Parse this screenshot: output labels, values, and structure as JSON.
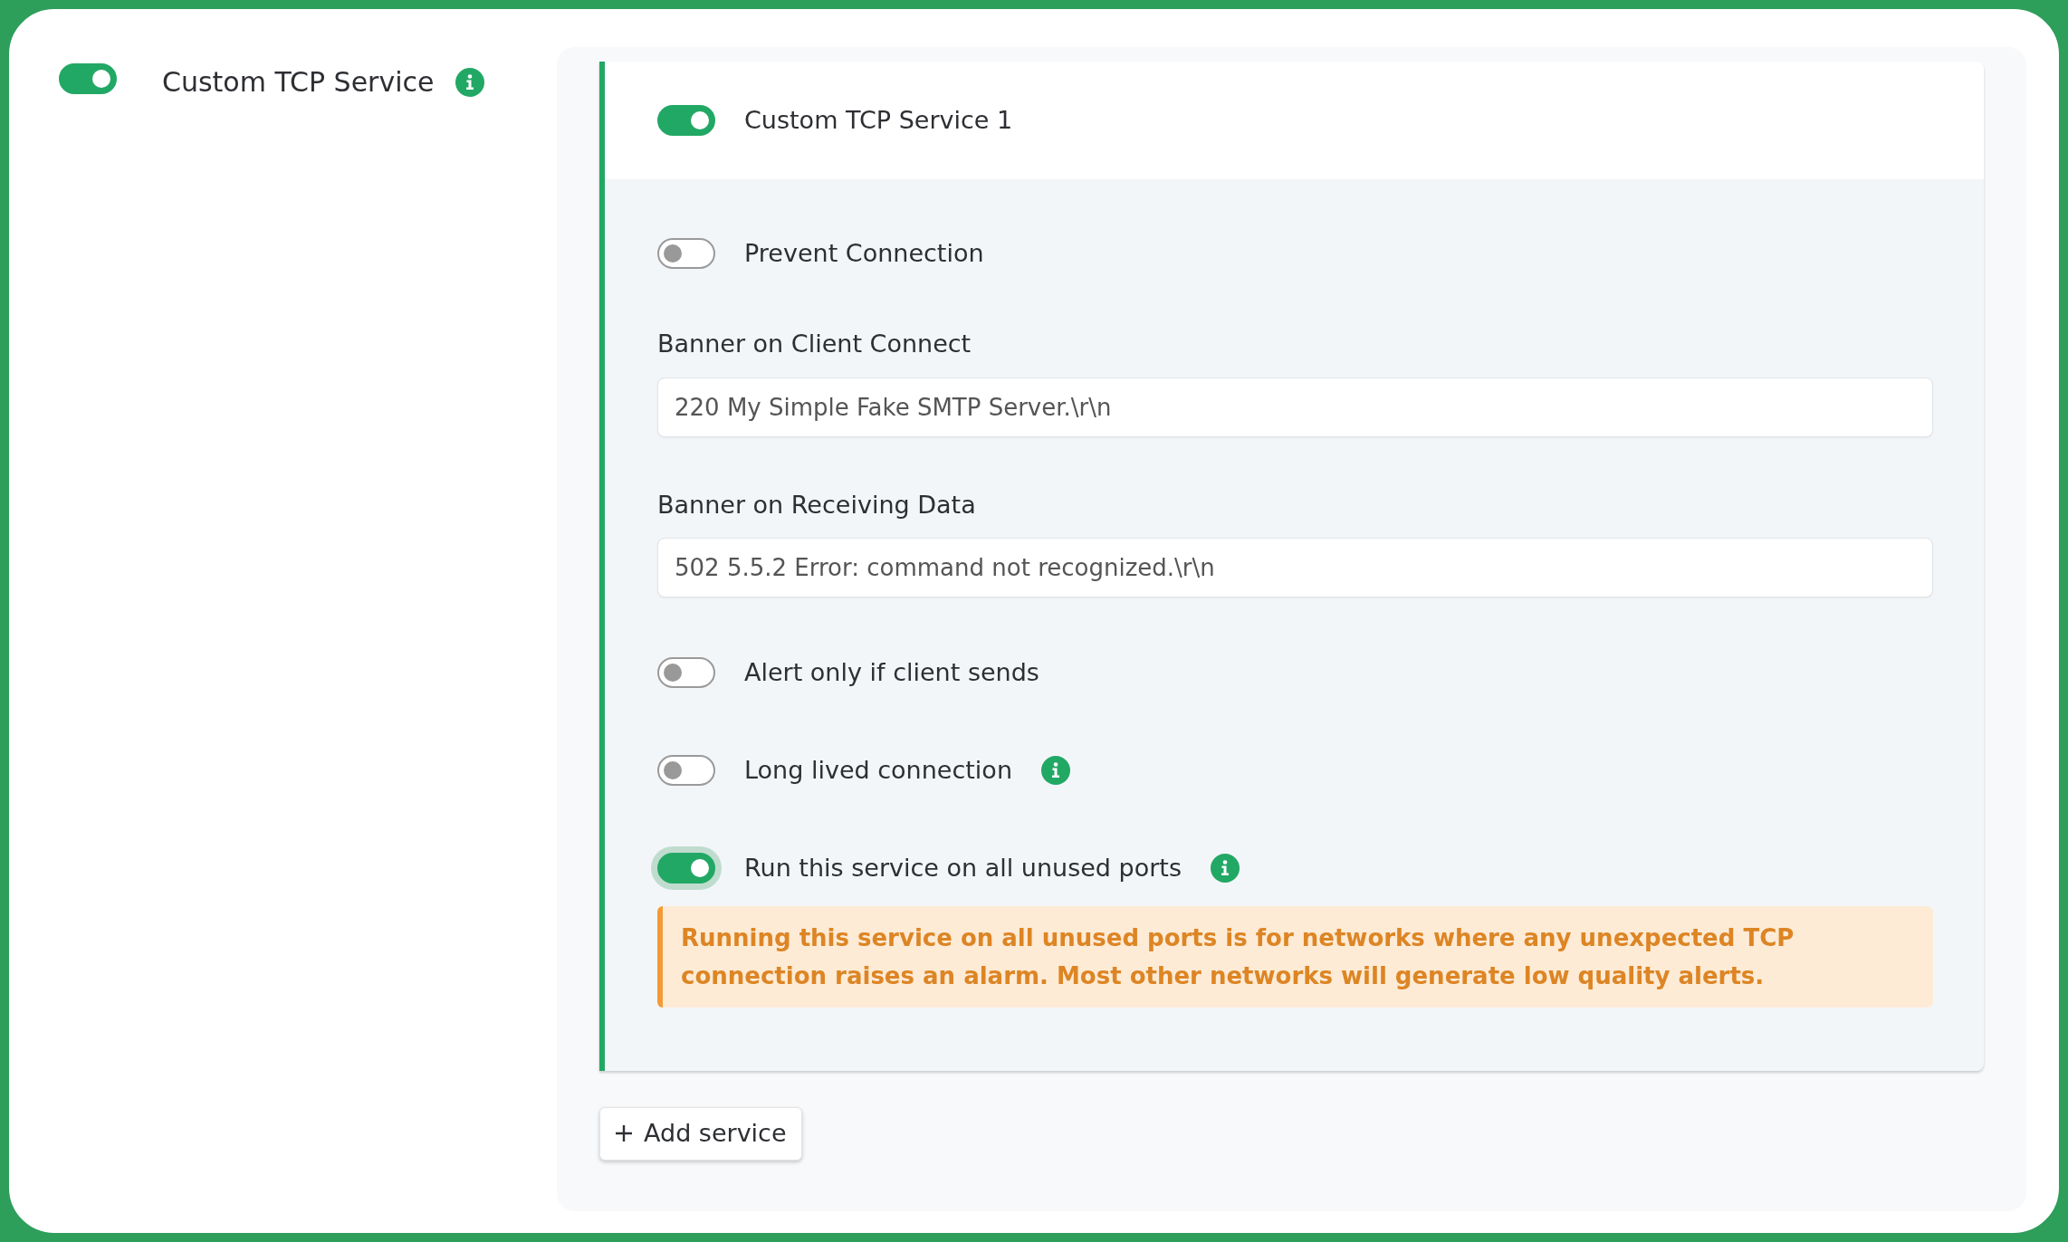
{
  "service": {
    "enabled": true,
    "label": "Custom TCP Service",
    "info": true
  },
  "card": {
    "enabled": true,
    "title": "Custom TCP Service 1"
  },
  "settings": [
    {
      "kind": "toggle",
      "label": "Prevent Connection",
      "on": false,
      "focused": false,
      "info": false
    },
    {
      "kind": "field",
      "label": "Banner on Client Connect",
      "value": "220 My Simple Fake SMTP Server.\\r\\n"
    },
    {
      "kind": "field",
      "label": "Banner on Receiving Data",
      "value": "502 5.5.2 Error: command not recognized.\\r\\n"
    },
    {
      "kind": "toggle",
      "label": "Alert only if client sends",
      "on": false,
      "focused": false,
      "info": false
    },
    {
      "kind": "toggle",
      "label": "Long lived connection",
      "on": false,
      "focused": false,
      "info": true
    },
    {
      "kind": "toggle",
      "label": "Run this service on all unused ports",
      "on": true,
      "focused": true,
      "info": true
    },
    {
      "kind": "warning",
      "text": "Running this service on all unused ports is for networks where any unexpected TCP connection raises an alarm. Most other networks will generate low quality alerts."
    }
  ],
  "add_button": "Add service"
}
